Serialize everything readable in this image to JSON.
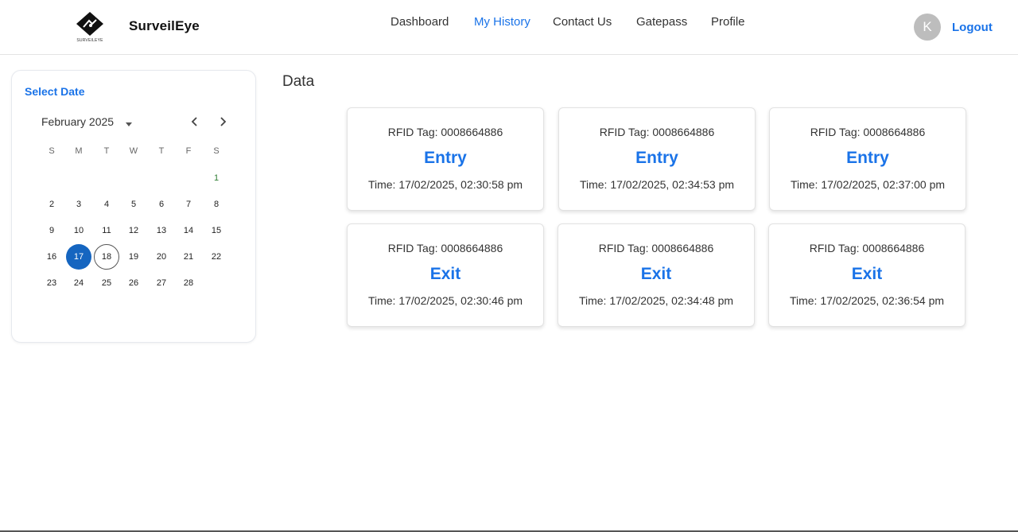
{
  "header": {
    "logo_caption": "SURVEILEYE",
    "brand": "SurveilEye",
    "nav": [
      "Dashboard",
      "My History",
      "Contact Us",
      "Gatepass",
      "Profile"
    ],
    "active_nav": "My History",
    "avatar_initial": "K",
    "logout_label": "Logout"
  },
  "calendar": {
    "title": "Select Date",
    "month_label": "February 2025",
    "weekdays": [
      "S",
      "M",
      "T",
      "W",
      "T",
      "F",
      "S"
    ],
    "days": [
      "1",
      "2",
      "3",
      "4",
      "5",
      "6",
      "7",
      "8",
      "9",
      "10",
      "11",
      "12",
      "13",
      "14",
      "15",
      "16",
      "17",
      "18",
      "19",
      "20",
      "21",
      "22",
      "23",
      "24",
      "25",
      "26",
      "27",
      "28"
    ],
    "selected_day": "17",
    "today_day": "18"
  },
  "data_section": {
    "title": "Data",
    "records": [
      {
        "rfid": "RFID Tag: 0008664886",
        "type": "Entry",
        "time": "Time: 17/02/2025, 02:30:58 pm"
      },
      {
        "rfid": "RFID Tag: 0008664886",
        "type": "Entry",
        "time": "Time: 17/02/2025, 02:34:53 pm"
      },
      {
        "rfid": "RFID Tag: 0008664886",
        "type": "Entry",
        "time": "Time: 17/02/2025, 02:37:00 pm"
      },
      {
        "rfid": "RFID Tag: 0008664886",
        "type": "Exit",
        "time": "Time: 17/02/2025, 02:30:46 pm"
      },
      {
        "rfid": "RFID Tag: 0008664886",
        "type": "Exit",
        "time": "Time: 17/02/2025, 02:34:48 pm"
      },
      {
        "rfid": "RFID Tag: 0008664886",
        "type": "Exit",
        "time": "Time: 17/02/2025, 02:36:54 pm"
      }
    ]
  },
  "colors": {
    "accent": "#1a73e8",
    "selected_day": "#1565c0",
    "avatar": "#bdbdbd"
  },
  "icons": {
    "logo": "surveileye-logo-icon",
    "month_dropdown": "caret-down-icon",
    "prev": "chevron-left-icon",
    "next": "chevron-right-icon"
  }
}
